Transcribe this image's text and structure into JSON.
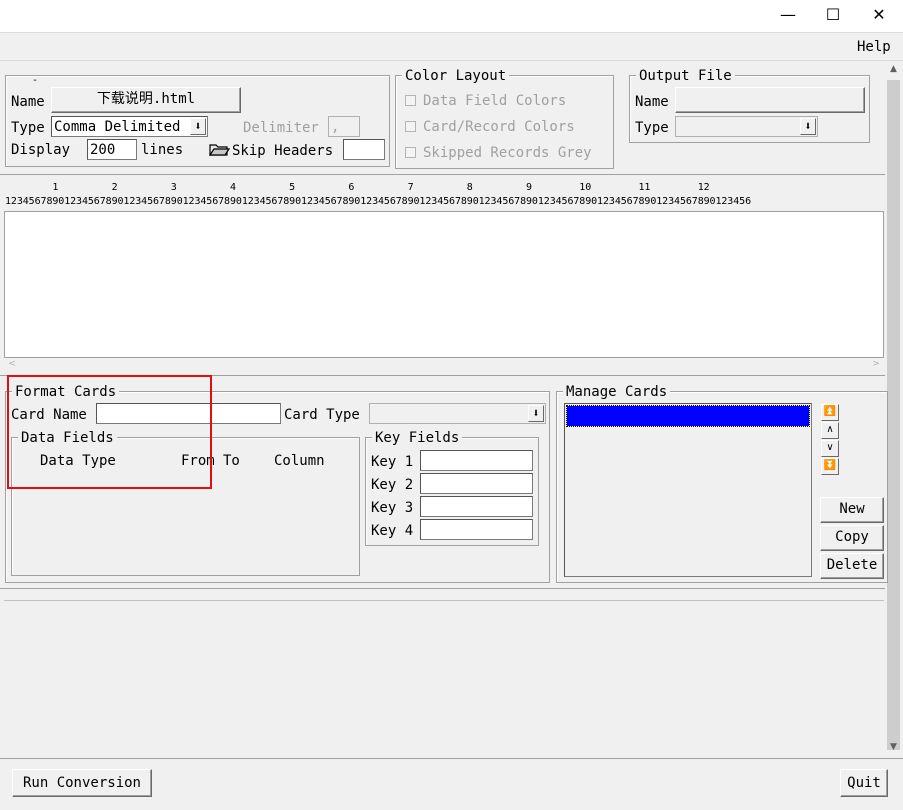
{
  "window": {
    "minimize": "—",
    "maximize": "☐",
    "close": "✕"
  },
  "menu": {
    "help": "Help"
  },
  "file_panel": {
    "name_label": "Name",
    "name_value": "下载说明.html",
    "type_label": "Type",
    "type_value": "Comma Delimited",
    "delimiter_label": "Delimiter",
    "delimiter_value": ",",
    "display_label": "Display",
    "display_value": "200",
    "lines_label": "lines",
    "skip_headers_label": "Skip Headers",
    "skip_headers_value": ""
  },
  "color_layout": {
    "legend": "Color Layout",
    "data_field_colors": "Data Field Colors",
    "card_record_colors": "Card/Record Colors",
    "skipped_records_grey": "Skipped Records Grey"
  },
  "output_file": {
    "legend": "Output File",
    "name_label": "Name",
    "type_label": "Type"
  },
  "ruler": {
    "tens": "        1         2         3         4         5         6         7         8         9        10        11        12",
    "units": "123456789012345678901234567890123456789012345678901234567890123456789012345678901234567890123456789012345678901234567890123456"
  },
  "format_cards": {
    "legend": "Format Cards",
    "card_name_label": "Card Name",
    "card_type_label": "Card Type",
    "data_fields": {
      "legend": "Data Fields",
      "col_data_type": "Data Type",
      "col_from": "From",
      "col_to": "To",
      "col_column": "Column"
    },
    "key_fields": {
      "legend": "Key Fields",
      "keys": [
        "Key 1",
        "Key 2",
        "Key 3",
        "Key 4"
      ]
    }
  },
  "manage_cards": {
    "legend": "Manage Cards",
    "new": "New",
    "copy": "Copy",
    "delete": "Delete",
    "selection_color": "#0000ff"
  },
  "footer": {
    "run_conversion": "Run Conversion",
    "quit": "Quit"
  },
  "colors": {
    "highlight_box": "#e01010"
  }
}
